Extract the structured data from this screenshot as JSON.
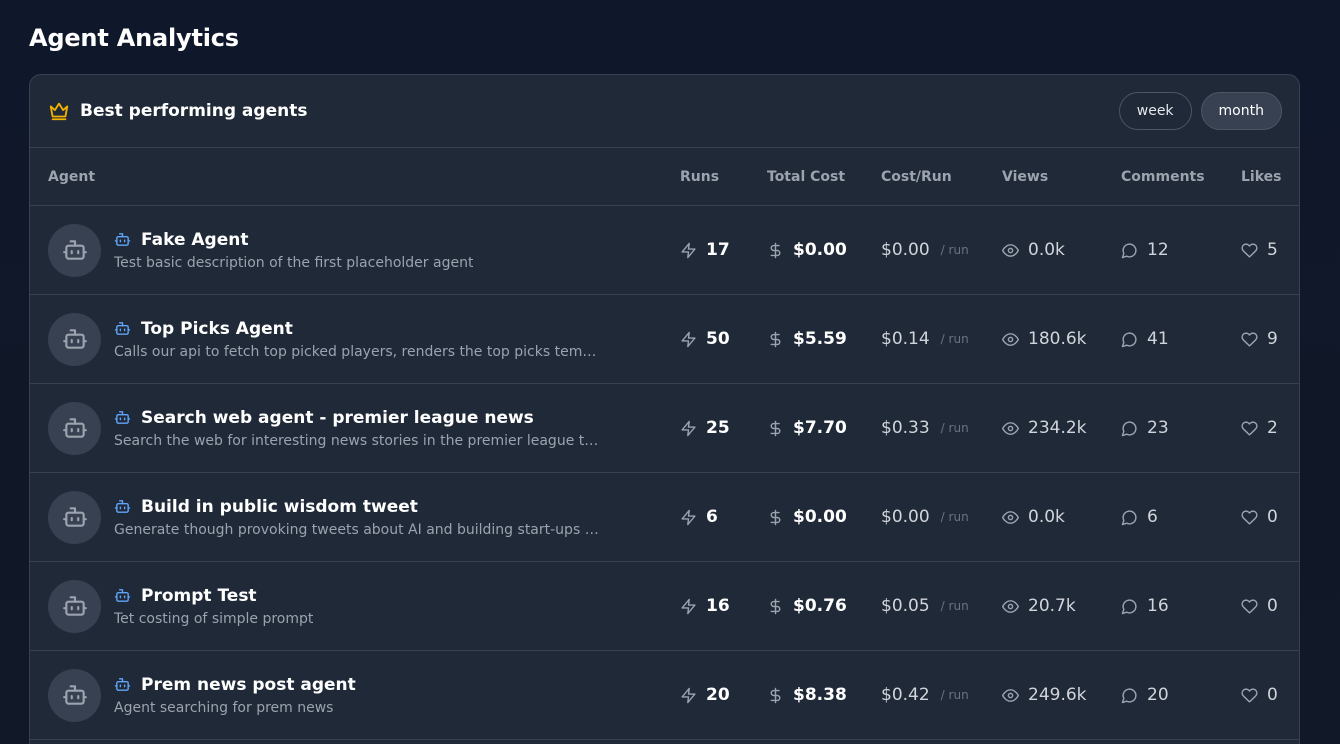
{
  "page": {
    "title": "Agent Analytics"
  },
  "card": {
    "title": "Best performing agents",
    "toggle": {
      "week": "week",
      "month": "month",
      "active": "month"
    }
  },
  "table": {
    "headers": {
      "agent": "Agent",
      "runs": "Runs",
      "total_cost": "Total Cost",
      "cost_per_run": "Cost/Run",
      "views": "Views",
      "comments": "Comments",
      "likes": "Likes"
    },
    "per_run_suffix": "/ run",
    "rows": [
      {
        "name": "Fake Agent",
        "description": "Test basic description of the first placeholder agent",
        "runs": "17",
        "total_cost": "$0.00",
        "cost_per_run": "$0.00",
        "views": "0.0k",
        "comments": "12",
        "likes": "5"
      },
      {
        "name": "Top Picks Agent",
        "description": "Calls our api to fetch top picked players, renders the top picks templat...",
        "runs": "50",
        "total_cost": "$5.59",
        "cost_per_run": "$0.14",
        "views": "180.6k",
        "comments": "41",
        "likes": "9"
      },
      {
        "name": "Search web agent - premier league news",
        "description": "Search the web for interesting news stories in the premier league this ...",
        "runs": "25",
        "total_cost": "$7.70",
        "cost_per_run": "$0.33",
        "views": "234.2k",
        "comments": "23",
        "likes": "2"
      },
      {
        "name": "Build in public wisdom tweet",
        "description": "Generate though provoking tweets about AI and building start-ups as ...",
        "runs": "6",
        "total_cost": "$0.00",
        "cost_per_run": "$0.00",
        "views": "0.0k",
        "comments": "6",
        "likes": "0"
      },
      {
        "name": "Prompt Test",
        "description": "Tet costing of simple prompt",
        "runs": "16",
        "total_cost": "$0.76",
        "cost_per_run": "$0.05",
        "views": "20.7k",
        "comments": "16",
        "likes": "0"
      },
      {
        "name": "Prem news post agent",
        "description": "Agent searching for prem news",
        "runs": "20",
        "total_cost": "$8.38",
        "cost_per_run": "$0.42",
        "views": "249.6k",
        "comments": "20",
        "likes": "0"
      }
    ]
  },
  "icons": {
    "title": "crown-icon",
    "avatar": "robot-icon",
    "agent_tag": "bot-icon",
    "runs": "zap-icon",
    "cost": "dollar-icon",
    "views": "eye-icon",
    "comments": "message-circle-icon",
    "likes": "heart-icon"
  },
  "colors": {
    "background": "#111827",
    "card": "#1f2937",
    "border": "#374151",
    "crown": "#f5b301",
    "bot_accent": "#60a5fa",
    "muted_text": "#9ca3af"
  }
}
